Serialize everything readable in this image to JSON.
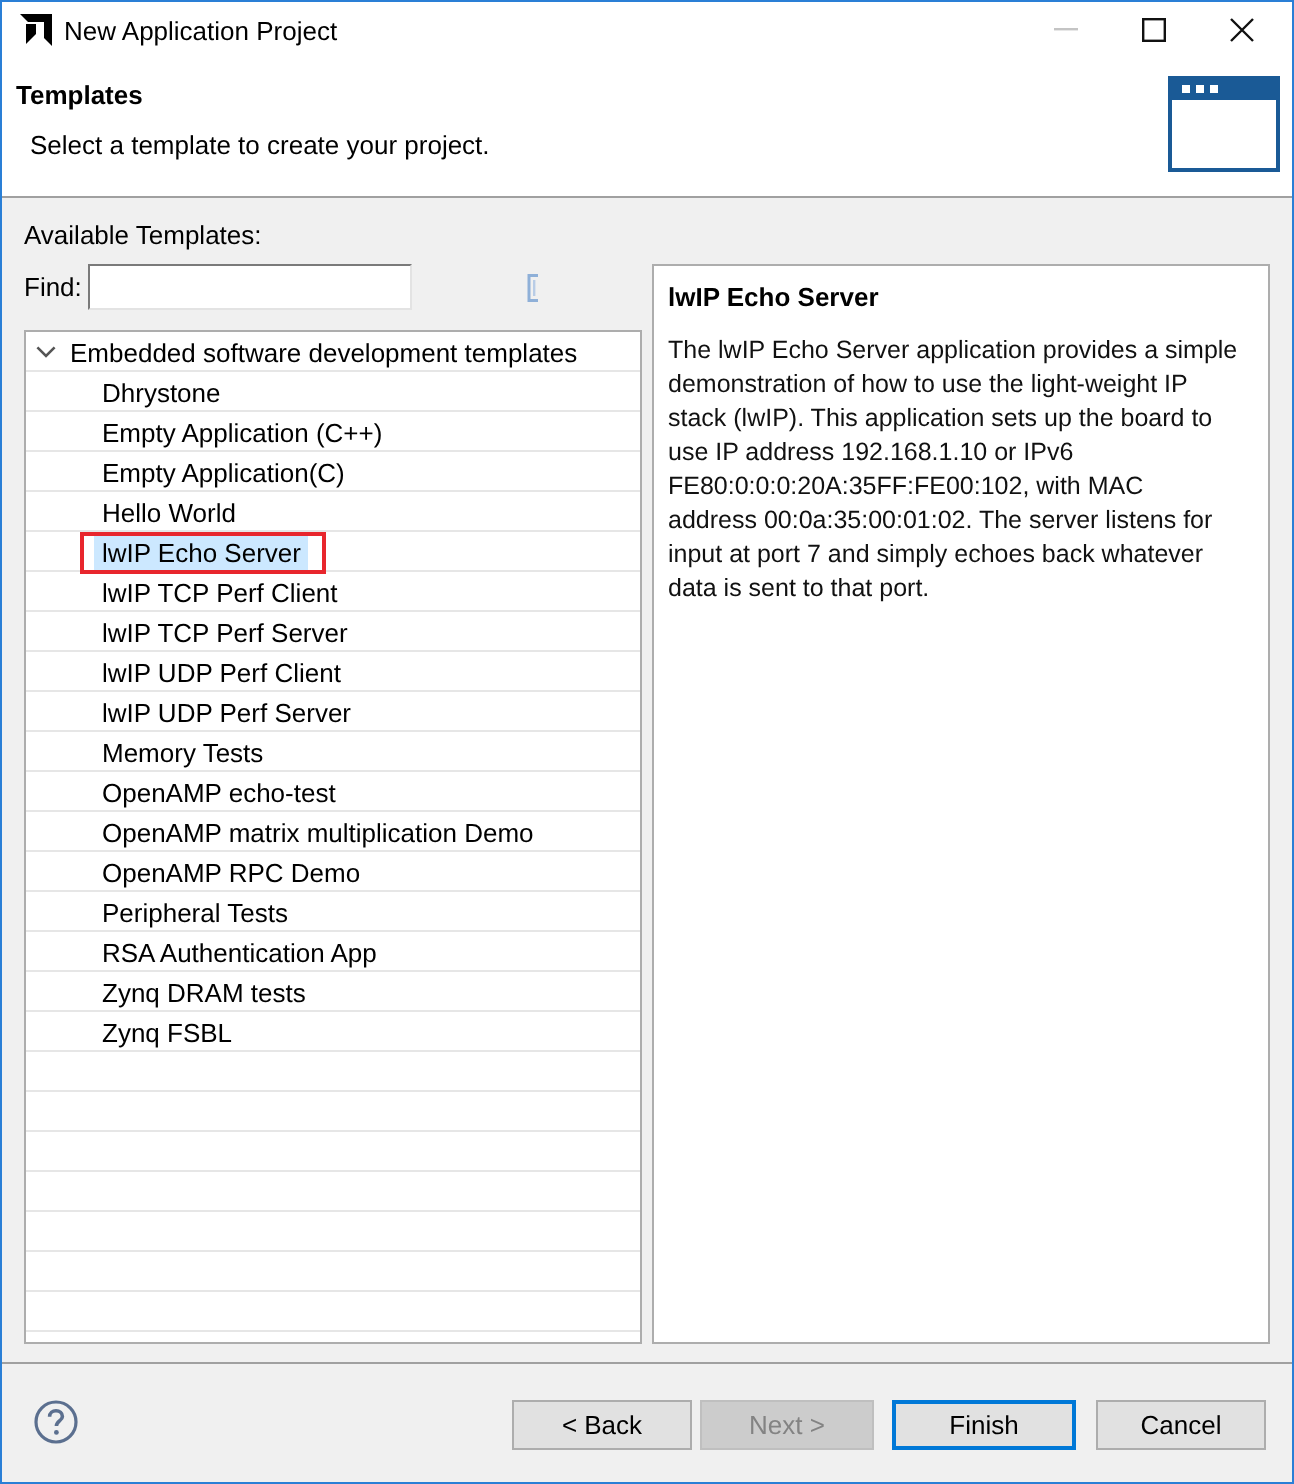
{
  "window": {
    "title": "New Application Project",
    "controls": [
      {
        "kind": "minimize",
        "disabled": true
      },
      {
        "kind": "maximize",
        "disabled": false
      },
      {
        "kind": "close",
        "disabled": false
      }
    ]
  },
  "header": {
    "title": "Templates",
    "subtitle": "Select a template to create your project."
  },
  "templates": {
    "label": "Available Templates:",
    "find_label": "Find:"
  },
  "tree": {
    "root": {
      "label": "Embedded software development templates",
      "expanded": true,
      "children": [
        {
          "label": "Dhrystone",
          "selected": false,
          "marked": false
        },
        {
          "label": "Empty Application (C++)",
          "selected": false,
          "marked": false
        },
        {
          "label": "Empty Application(C)",
          "selected": false,
          "marked": false
        },
        {
          "label": "Hello World",
          "selected": false,
          "marked": false
        },
        {
          "label": "lwIP Echo Server",
          "selected": true,
          "marked": true
        },
        {
          "label": "lwIP TCP Perf Client",
          "selected": false,
          "marked": false
        },
        {
          "label": "lwIP TCP Perf Server",
          "selected": false,
          "marked": false
        },
        {
          "label": "lwIP UDP Perf Client",
          "selected": false,
          "marked": false
        },
        {
          "label": "lwIP UDP Perf Server",
          "selected": false,
          "marked": false
        },
        {
          "label": "Memory Tests",
          "selected": false,
          "marked": false
        },
        {
          "label": "OpenAMP echo-test",
          "selected": false,
          "marked": false
        },
        {
          "label": "OpenAMP matrix multiplication Demo",
          "selected": false,
          "marked": false
        },
        {
          "label": "OpenAMP RPC Demo",
          "selected": false,
          "marked": false
        },
        {
          "label": "Peripheral Tests",
          "selected": false,
          "marked": false
        },
        {
          "label": "RSA Authentication App",
          "selected": false,
          "marked": false
        },
        {
          "label": "Zynq DRAM tests",
          "selected": false,
          "marked": false
        },
        {
          "label": "Zynq FSBL",
          "selected": false,
          "marked": false
        }
      ]
    }
  },
  "description": {
    "title": "lwIP Echo Server",
    "text": "The lwIP Echo Server application provides a simple demonstration of how to use the light-weight IP stack (lwIP). This application sets up the board to use IP address 192.168.1.10 or IPv6 FE80:0:0:0:20A:35FF:FE00:102, with MAC address 00:0a:35:00:01:02. The server listens for input at port 7 and simply echoes back whatever data is sent to that port."
  },
  "buttons": [
    {
      "label": "< Back",
      "disabled": false,
      "default": false
    },
    {
      "label": "Next >",
      "disabled": true,
      "default": false
    },
    {
      "label": "Finish",
      "disabled": false,
      "default": true
    },
    {
      "label": "Cancel",
      "disabled": false,
      "default": false
    }
  ]
}
